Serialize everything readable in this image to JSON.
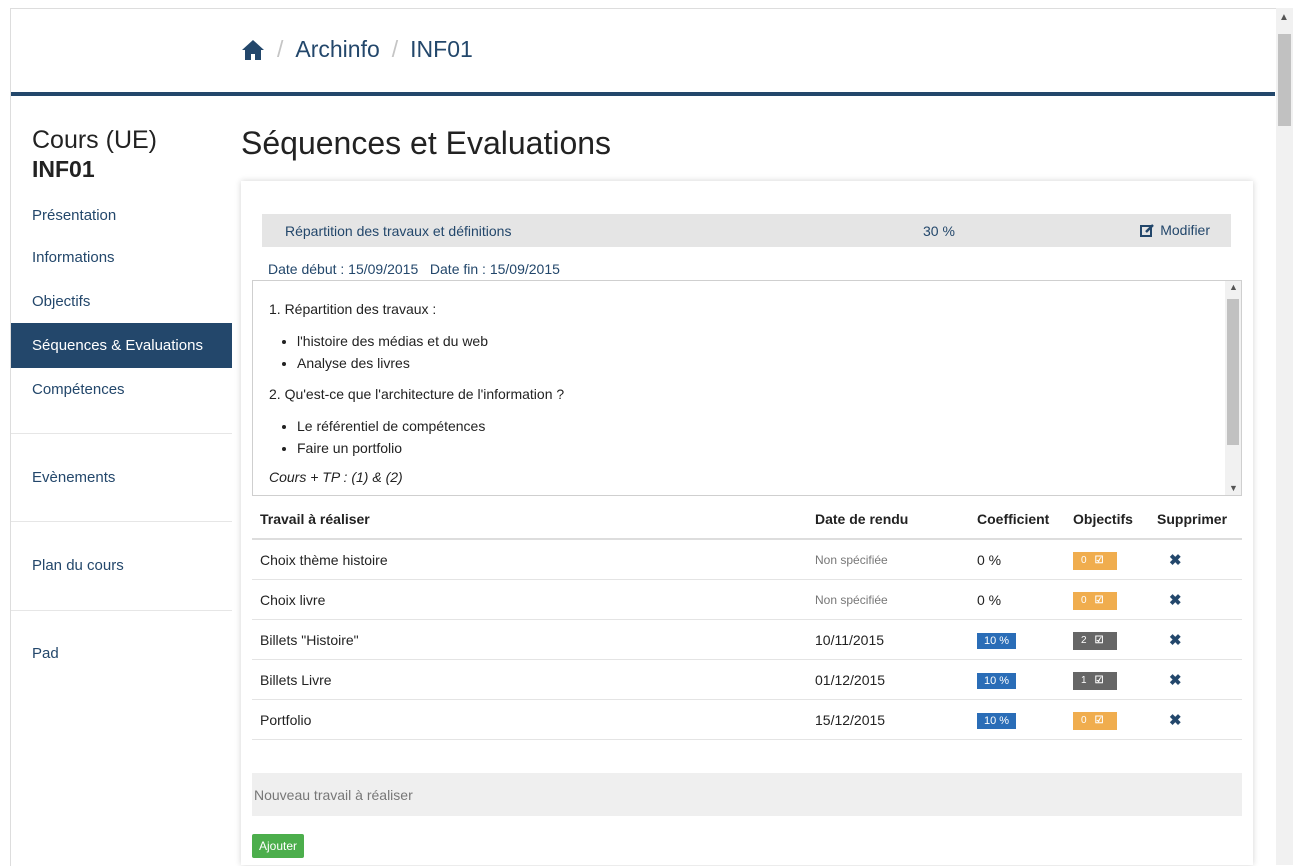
{
  "breadcrumb": {
    "items": [
      "Archinfo",
      "INF01"
    ],
    "separator": "/"
  },
  "sidebar": {
    "course_kind": "Cours (UE)",
    "course_code": "INF01",
    "items": [
      {
        "label": "Présentation"
      },
      {
        "label": "Informations"
      },
      {
        "label": "Objectifs"
      },
      {
        "label": "Séquences & Evaluations",
        "active": true
      },
      {
        "label": "Compétences"
      },
      {
        "label": "Evènements"
      },
      {
        "label": "Plan du cours"
      },
      {
        "label": "Pad"
      }
    ]
  },
  "page_title": "Séquences et Evaluations",
  "sequence": {
    "name": "Répartition des travaux et définitions",
    "percent": "30 %",
    "edit_label": "Modifier",
    "date_start": "Date début : 15/09/2015",
    "date_end": "Date fin : 15/09/2015",
    "description": {
      "item1": "1. Répartition des travaux :",
      "item1_bullets": [
        "l'histoire des médias et du web",
        "Analyse des livres"
      ],
      "item2": "2. Qu'est-ce que l'architecture de l'information ?",
      "item2_bullets": [
        "Le référentiel de compétences",
        "Faire un portfolio"
      ],
      "note": "Cours + TP : (1) & (2)"
    }
  },
  "table": {
    "headers": [
      "Travail à réaliser",
      "Date de rendu",
      "Coefficient",
      "Objectifs",
      "Supprimer"
    ],
    "rows": [
      {
        "name": "Choix thème histoire",
        "date": "Non spécifiée",
        "coef": "0 %",
        "obj": "0",
        "obj_color": "orange"
      },
      {
        "name": "Choix livre",
        "date": "Non spécifiée",
        "coef": "0 %",
        "obj": "0",
        "obj_color": "orange"
      },
      {
        "name": "Billets \"Histoire\"",
        "date": "10/11/2015",
        "coef": "10 %",
        "obj": "2",
        "obj_color": "gray"
      },
      {
        "name": "Billets Livre",
        "date": "01/12/2015",
        "coef": "10 %",
        "obj": "1",
        "obj_color": "gray"
      },
      {
        "name": "Portfolio",
        "date": "15/12/2015",
        "coef": "10 %",
        "obj": "0",
        "obj_color": "orange"
      }
    ]
  },
  "new_work": {
    "placeholder": "Nouveau travail à réaliser"
  },
  "add_button": "Ajouter",
  "colors": {
    "primary": "#23476b",
    "orange": "#f0ad4e",
    "gray": "#666666",
    "blue": "#2a6db7",
    "green": "#4cae4c"
  }
}
